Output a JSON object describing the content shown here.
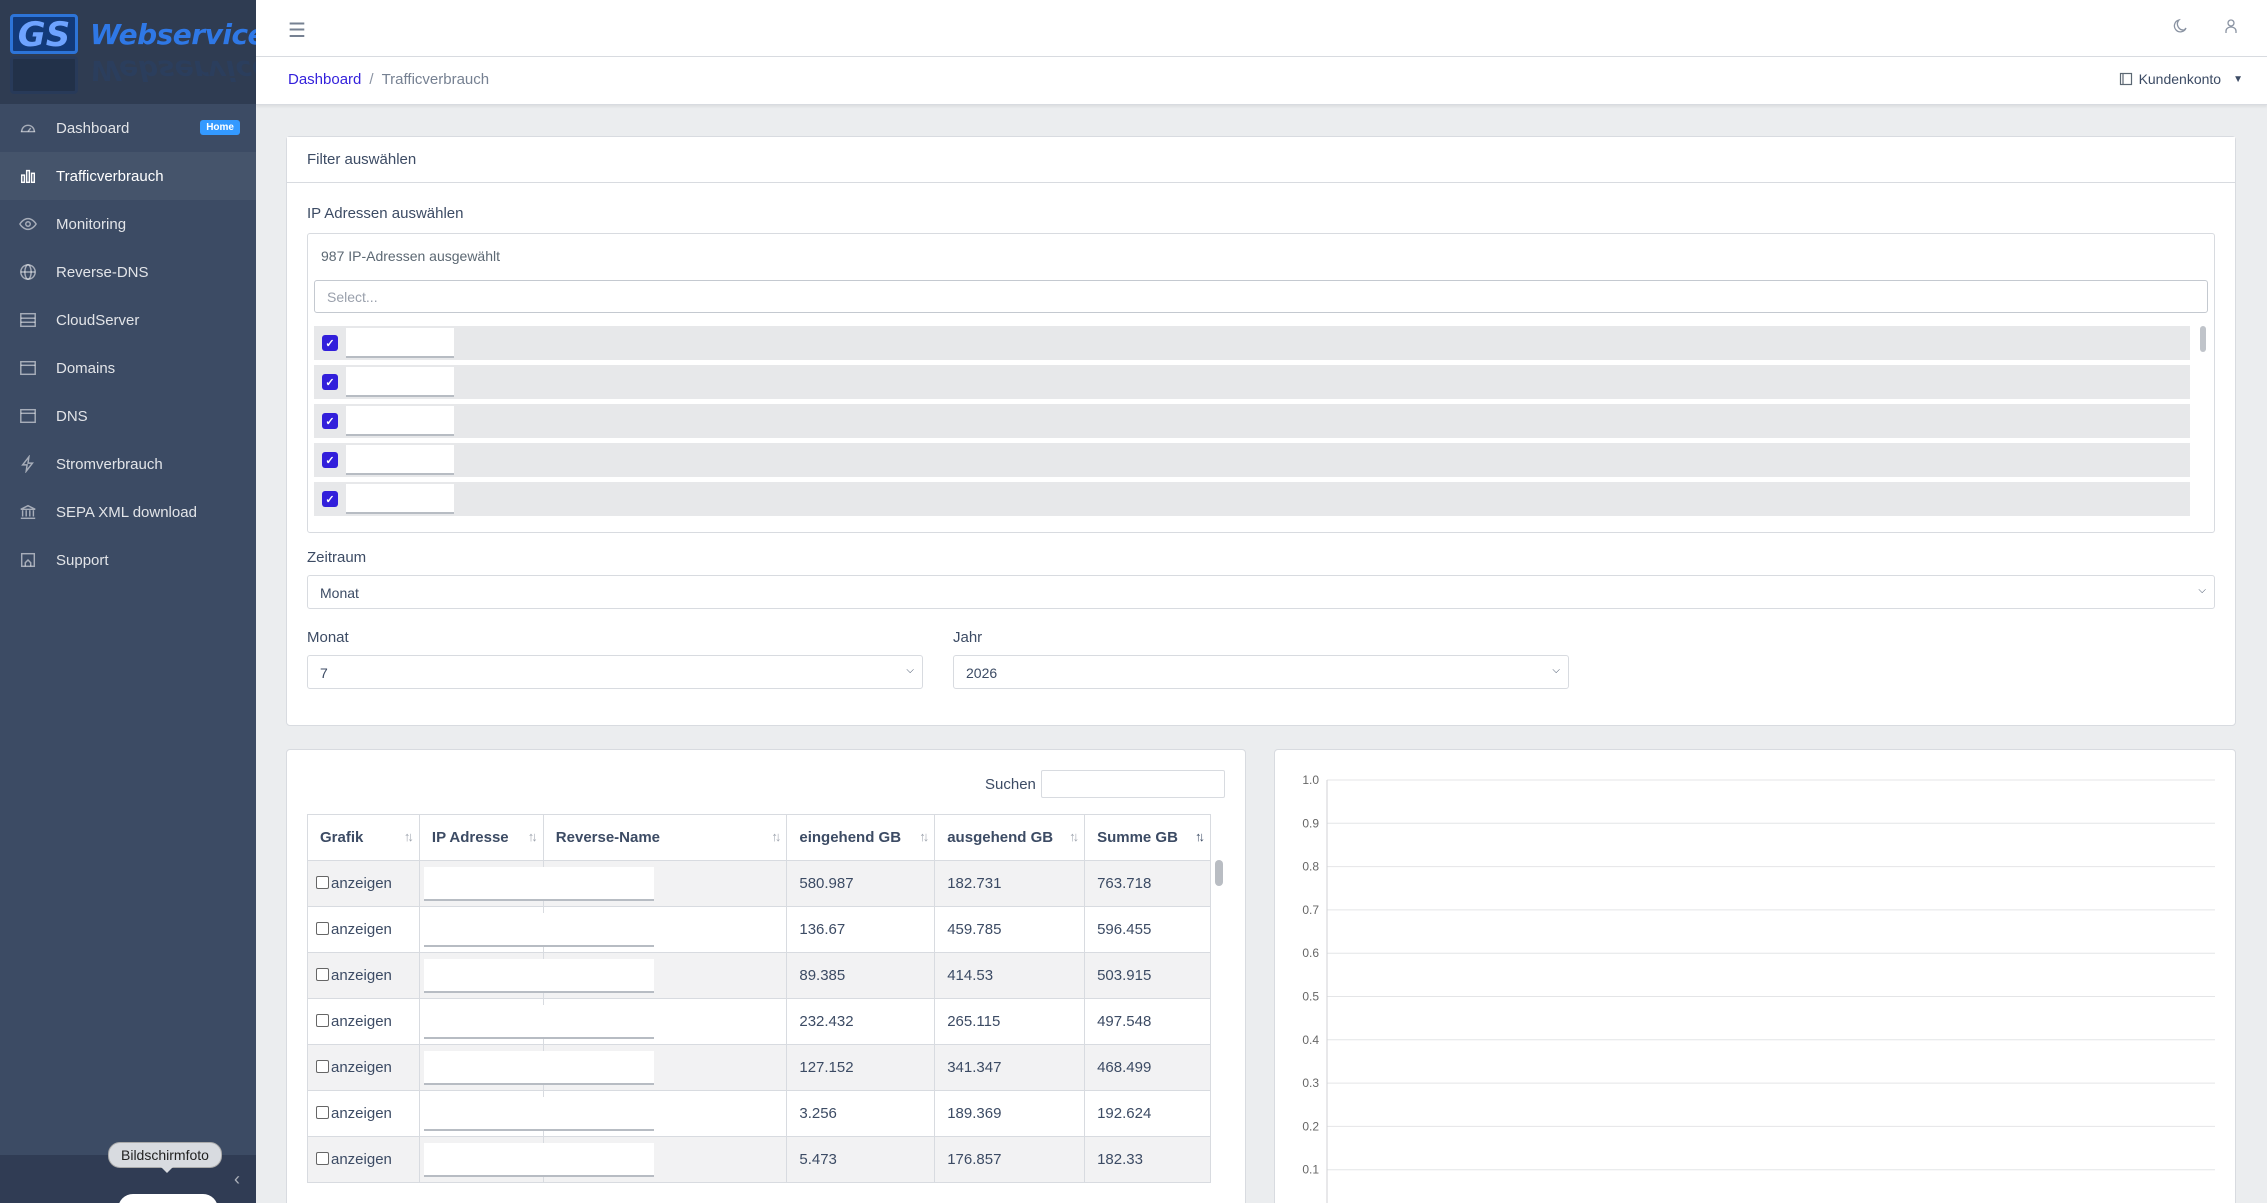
{
  "brand": {
    "logo_mark": "GS",
    "logo_text": "Webservices"
  },
  "sidebar": {
    "items": [
      {
        "label": "Dashboard",
        "icon": "speedometer-icon",
        "badge": "Home",
        "active": false
      },
      {
        "label": "Trafficverbrauch",
        "icon": "chart-icon",
        "active": true
      },
      {
        "label": "Monitoring",
        "icon": "eye-icon",
        "active": false
      },
      {
        "label": "Reverse-DNS",
        "icon": "globe-icon",
        "active": false
      },
      {
        "label": "CloudServer",
        "icon": "server-icon",
        "active": false
      },
      {
        "label": "Domains",
        "icon": "browser-icon",
        "active": false
      },
      {
        "label": "DNS",
        "icon": "browser-icon",
        "active": false
      },
      {
        "label": "Stromverbrauch",
        "icon": "bolt-icon",
        "active": false
      },
      {
        "label": "SEPA XML download",
        "icon": "bank-icon",
        "active": false
      },
      {
        "label": "Support",
        "icon": "support-icon",
        "active": false
      }
    ],
    "tooltip": "Bildschirmfoto"
  },
  "breadcrumb": {
    "home": "Dashboard",
    "separator": "/",
    "current": "Trafficverbrauch"
  },
  "header": {
    "account": "Kundenkonto"
  },
  "filter": {
    "title": "Filter auswählen",
    "ip_label": "IP Adressen auswählen",
    "ip_count": "987 IP-Adressen ausgewählt",
    "ip_placeholder": "Select...",
    "zeitraum_label": "Zeitraum",
    "zeitraum_value": "Monat",
    "monat_label": "Monat",
    "monat_value": "7",
    "jahr_label": "Jahr",
    "jahr_value": "2026"
  },
  "table": {
    "search_label": "Suchen",
    "columns": [
      "Grafik",
      "IP Adresse",
      "Reverse-Name",
      "eingehend GB",
      "ausgehend GB",
      "Summe GB"
    ],
    "show_label": "anzeigen",
    "rows": [
      {
        "in": "580.987",
        "out": "182.731",
        "sum": "763.718"
      },
      {
        "in": "136.67",
        "out": "459.785",
        "sum": "596.455"
      },
      {
        "in": "89.385",
        "out": "414.53",
        "sum": "503.915"
      },
      {
        "in": "232.432",
        "out": "265.115",
        "sum": "497.548"
      },
      {
        "in": "127.152",
        "out": "341.347",
        "sum": "468.499"
      },
      {
        "in": "3.256",
        "out": "189.369",
        "sum": "192.624"
      },
      {
        "in": "5.473",
        "out": "176.857",
        "sum": "182.33"
      }
    ]
  },
  "chart_data": {
    "type": "line",
    "series": [],
    "y_ticks": [
      "1.0",
      "0.9",
      "0.8",
      "0.7",
      "0.6",
      "0.5",
      "0.4",
      "0.3",
      "0.2",
      "0.1"
    ],
    "ylim": [
      0,
      1.0
    ],
    "grid": true
  }
}
